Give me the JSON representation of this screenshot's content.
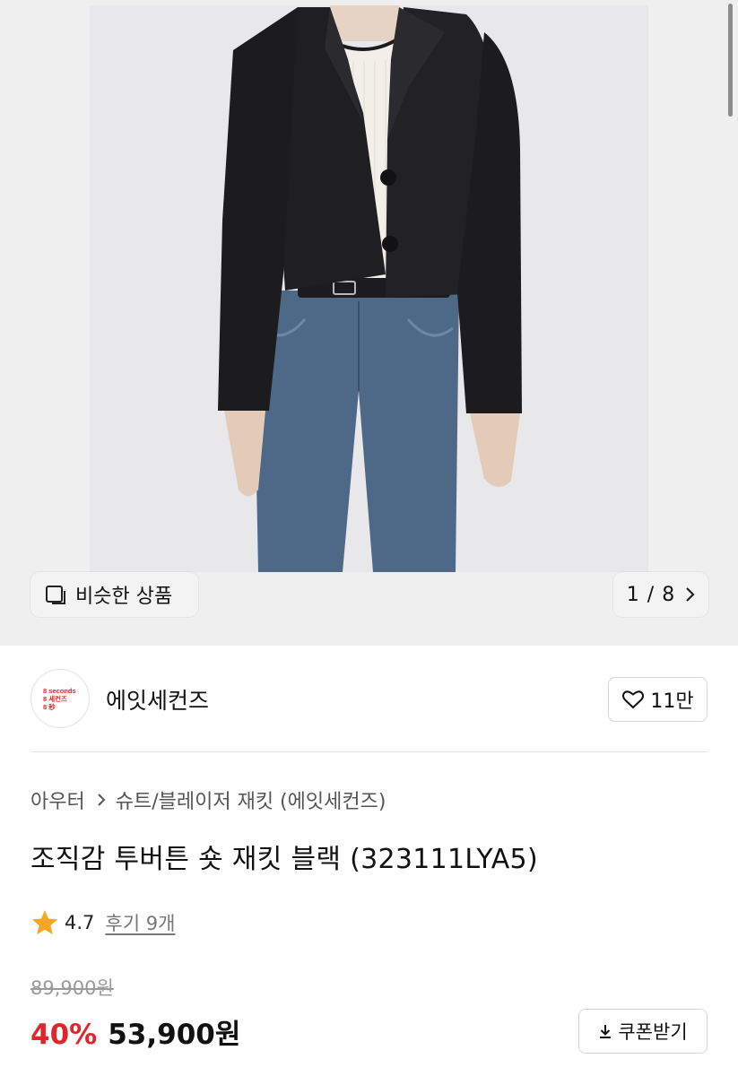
{
  "gallery": {
    "similar_label": "비슷한 상품",
    "counter": "1 / 8",
    "icons": {
      "similar": "similar-products-icon",
      "next": "chevron-right-icon"
    }
  },
  "brand": {
    "logo_lines": [
      "8 seconds",
      "8 세컨즈",
      "8 秒"
    ],
    "name": "에잇세컨즈",
    "like_count": "11만",
    "accent_color": "#e0262a"
  },
  "product": {
    "breadcrumb": [
      "아우터",
      "슈트/블레이저 재킷 (에잇세컨즈)"
    ],
    "title": "조직감 투버튼 숏 재킷 블랙 (323111LYA5)",
    "rating": "4.7",
    "review_link": "후기 9개",
    "original_price": "89,900원",
    "discount_rate": "40%",
    "sale_price": "53,900원",
    "coupon_label": "쿠폰받기"
  }
}
